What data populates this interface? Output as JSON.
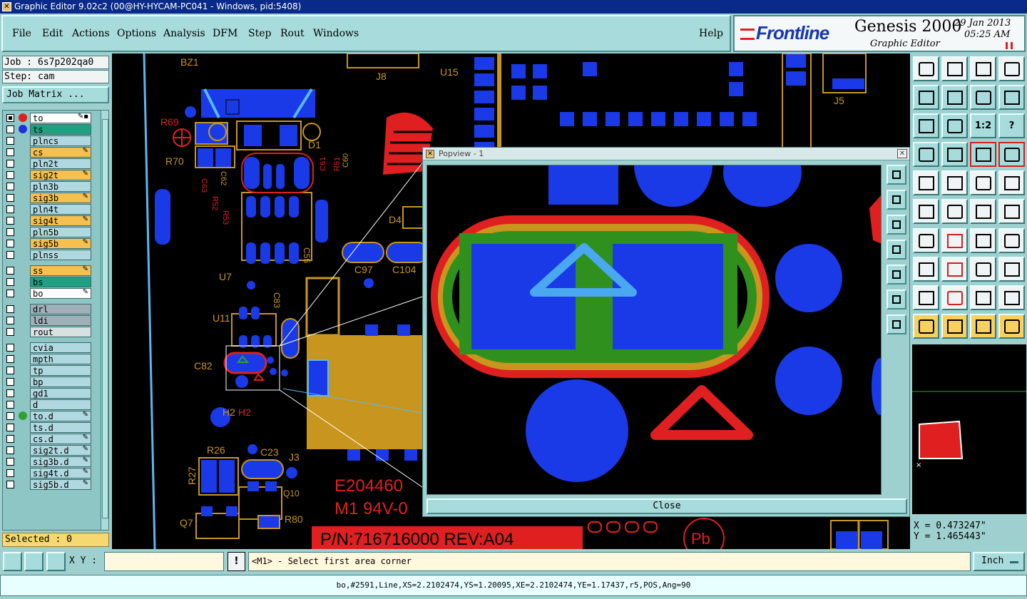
{
  "window": {
    "title": "Graphic Editor 9.02c2 (00@HY-HYCAM-PC041 - Windows, pid:5408)"
  },
  "menu": {
    "file": "File",
    "edit": "Edit",
    "actions": "Actions",
    "options": "Options",
    "analysis": "Analysis",
    "dfm": "DFM",
    "step": "Step",
    "rout": "Rout",
    "windows": "Windows",
    "help": "Help"
  },
  "brand": {
    "logo": "Frontline",
    "product": "Genesis 2000",
    "subtitle": "Graphic Editor",
    "date": "29 Jan 2013",
    "time": "05:25 AM"
  },
  "job": {
    "label": "Job : 6s7p202qa0",
    "step": "Step: cam",
    "matrix_button": "Job Matrix ..."
  },
  "layers": [
    {
      "name": "to",
      "color": "#ffffff",
      "dot": "#e02020",
      "flag": "✎▪"
    },
    {
      "name": "ts",
      "color": "#20a080",
      "dot": "#2030e0",
      "flag": ""
    },
    {
      "name": "plncs",
      "color": "#b0d8e0",
      "dot": "",
      "flag": ""
    },
    {
      "name": "cs",
      "color": "#f6c050",
      "dot": "",
      "flag": "✎"
    },
    {
      "name": "pln2t",
      "color": "#b0d8e0",
      "dot": "",
      "flag": ""
    },
    {
      "name": "sig2t",
      "color": "#f6c050",
      "dot": "",
      "flag": "✎"
    },
    {
      "name": "pln3b",
      "color": "#b0d8e0",
      "dot": "",
      "flag": ""
    },
    {
      "name": "sig3b",
      "color": "#f6c050",
      "dot": "",
      "flag": "✎"
    },
    {
      "name": "pln4t",
      "color": "#b0d8e0",
      "dot": "",
      "flag": ""
    },
    {
      "name": "sig4t",
      "color": "#f6c050",
      "dot": "",
      "flag": "✎"
    },
    {
      "name": "pln5b",
      "color": "#b0d8e0",
      "dot": "",
      "flag": ""
    },
    {
      "name": "sig5b",
      "color": "#f6c050",
      "dot": "",
      "flag": "✎"
    },
    {
      "name": "plnss",
      "color": "#b0d8e0",
      "dot": "",
      "flag": ""
    },
    {
      "name": "ss",
      "color": "#f6c050",
      "dot": "",
      "flag": "✎"
    },
    {
      "name": "bs",
      "color": "#20a080",
      "dot": "",
      "flag": ""
    },
    {
      "name": "bo",
      "color": "#ffffff",
      "dot": "",
      "flag": "✎"
    },
    {
      "name": "drl",
      "color": "#a0b0b8",
      "dot": "",
      "flag": ""
    },
    {
      "name": "ldi",
      "color": "#a0b0b8",
      "dot": "",
      "flag": ""
    },
    {
      "name": "rout",
      "color": "#d8e0e0",
      "dot": "",
      "flag": ""
    },
    {
      "name": "cvia",
      "color": "#b0d8e0",
      "dot": "",
      "flag": ""
    },
    {
      "name": "mpth",
      "color": "#b0d8e0",
      "dot": "",
      "flag": ""
    },
    {
      "name": "tp",
      "color": "#b0d8e0",
      "dot": "",
      "flag": ""
    },
    {
      "name": "bp",
      "color": "#b0d8e0",
      "dot": "",
      "flag": ""
    },
    {
      "name": "gd1",
      "color": "#b0d8e0",
      "dot": "",
      "flag": ""
    },
    {
      "name": "d",
      "color": "#b0d8e0",
      "dot": "",
      "flag": ""
    },
    {
      "name": "to.d",
      "color": "#b0d8e0",
      "dot": "#30a030",
      "flag": "✎"
    },
    {
      "name": "ts.d",
      "color": "#b0d8e0",
      "dot": "",
      "flag": ""
    },
    {
      "name": "cs.d",
      "color": "#b0d8e0",
      "dot": "",
      "flag": "✎"
    },
    {
      "name": "sig2t.d",
      "color": "#b0d8e0",
      "dot": "",
      "flag": "✎"
    },
    {
      "name": "sig3b.d",
      "color": "#b0d8e0",
      "dot": "",
      "flag": "✎"
    },
    {
      "name": "sig4t.d",
      "color": "#b0d8e0",
      "dot": "",
      "flag": "✎"
    },
    {
      "name": "sig5b.d",
      "color": "#b0d8e0",
      "dot": "",
      "flag": "✎"
    }
  ],
  "selected": "Selected : 0",
  "board_labels": {
    "bz1": "BZ1",
    "j8": "J8",
    "u15": "U15",
    "j5": "J5",
    "r69": "R69",
    "r70": "R70",
    "c63": "C63",
    "c62": "C62",
    "r52": "R52",
    "r53": "R53",
    "d1": "D1",
    "r51": "R51",
    "c60": "C60",
    "c61": "C61",
    "d4": "D4",
    "c55": "C55",
    "c97": "C97",
    "c104": "C104",
    "u7": "U7",
    "c83": "C83",
    "u11": "U11",
    "c82": "C82",
    "h2": "H2",
    "h2b": "H2",
    "r26": "R26",
    "c23": "C23",
    "j3": "J3",
    "r27": "R27",
    "q10": "Q10",
    "q7": "Q7",
    "r80": "R80",
    "e204460": "E204460",
    "m1": "M1  94V-0",
    "pn": "P/N:716716000  REV:A04",
    "pb": "Pb"
  },
  "popview": {
    "title": "Popview - 1",
    "close_label": "Close"
  },
  "toolbar_labels": {
    "one_two": "1:2",
    "question": "?"
  },
  "coords": {
    "x": "X = 0.473247\"",
    "y": "Y = 1.465443\""
  },
  "command": {
    "xy_label": "X Y :",
    "xy_value": "",
    "bang": "!",
    "prompt": "<M1> - Select first area corner",
    "unit": "Inch"
  },
  "status": "bo,#2591,Line,XS=2.2102474,YS=1.20095,XE=2.2102474,YE=1.17437,r5,POS,Ang=90"
}
